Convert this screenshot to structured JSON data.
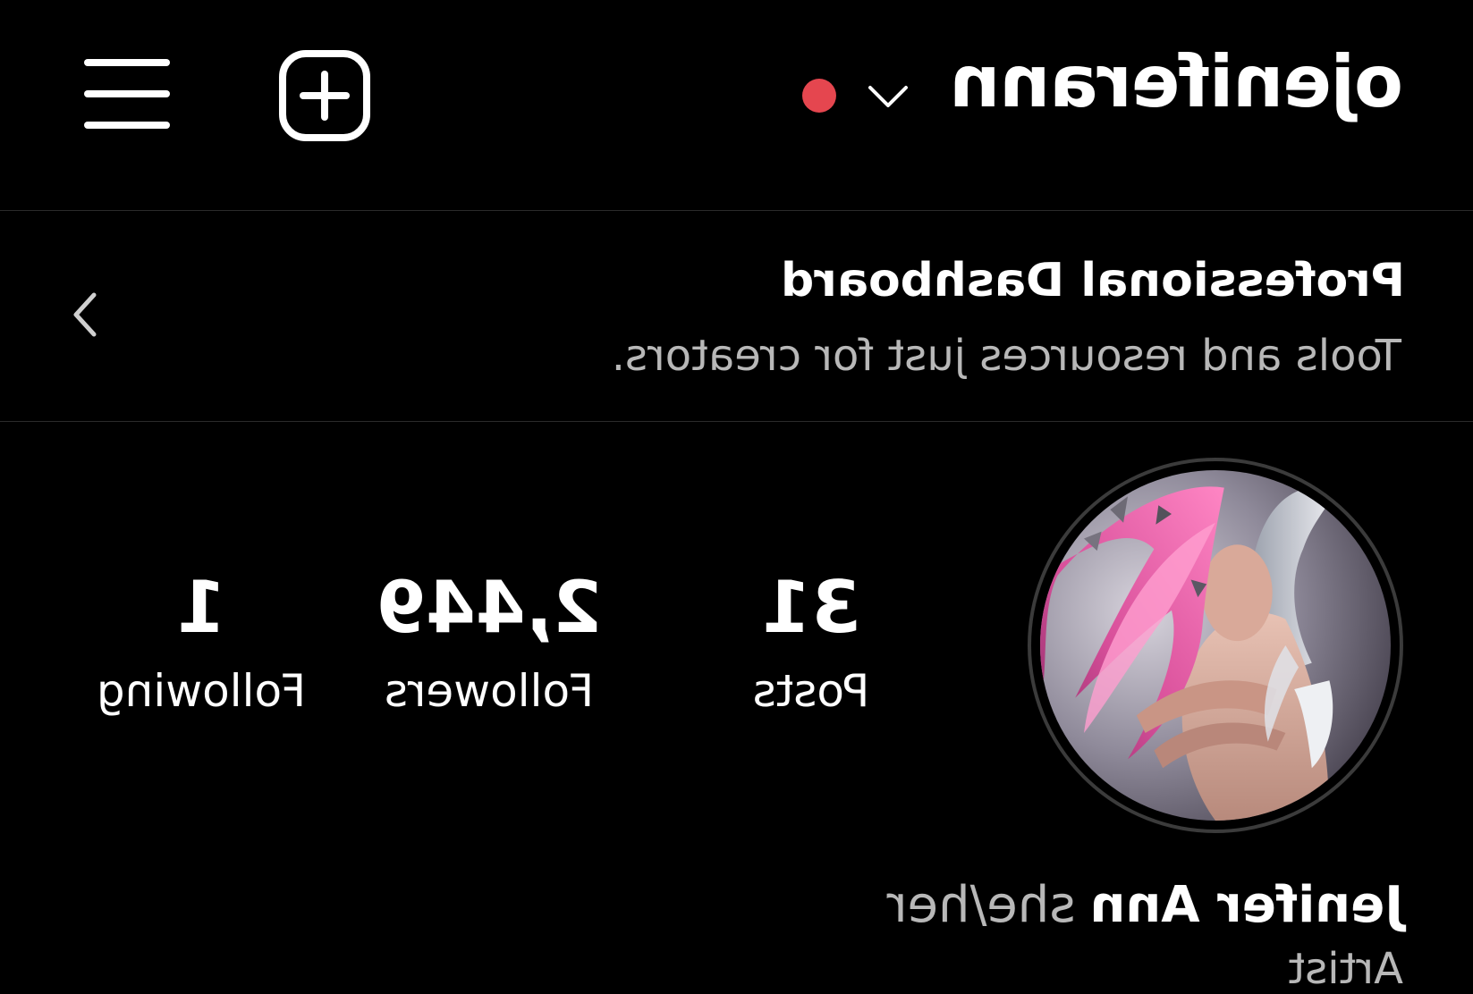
{
  "header": {
    "username": "ojeniferann",
    "live_indicator_color": "#e5464f",
    "icons": [
      "chevron-down-icon",
      "plus-square-icon",
      "hamburger-menu-icon"
    ]
  },
  "dashboard": {
    "title": "Professional Dashboard",
    "subtitle": "Tools and resources just for creators."
  },
  "profile": {
    "stats": [
      {
        "value": "31",
        "label": "Posts"
      },
      {
        "value": "2,449",
        "label": "Followers"
      },
      {
        "value": "1",
        "label": "Following"
      }
    ],
    "display_name": "Jenifer Ann",
    "pronouns": "she/her",
    "category": "Artist"
  },
  "colors": {
    "background": "#000000",
    "text_primary": "#ffffff",
    "text_secondary": "#b8b8b8",
    "divider": "#2a2a2a",
    "avatar_ring": "#3b3b3b",
    "live_dot": "#e5464f"
  }
}
